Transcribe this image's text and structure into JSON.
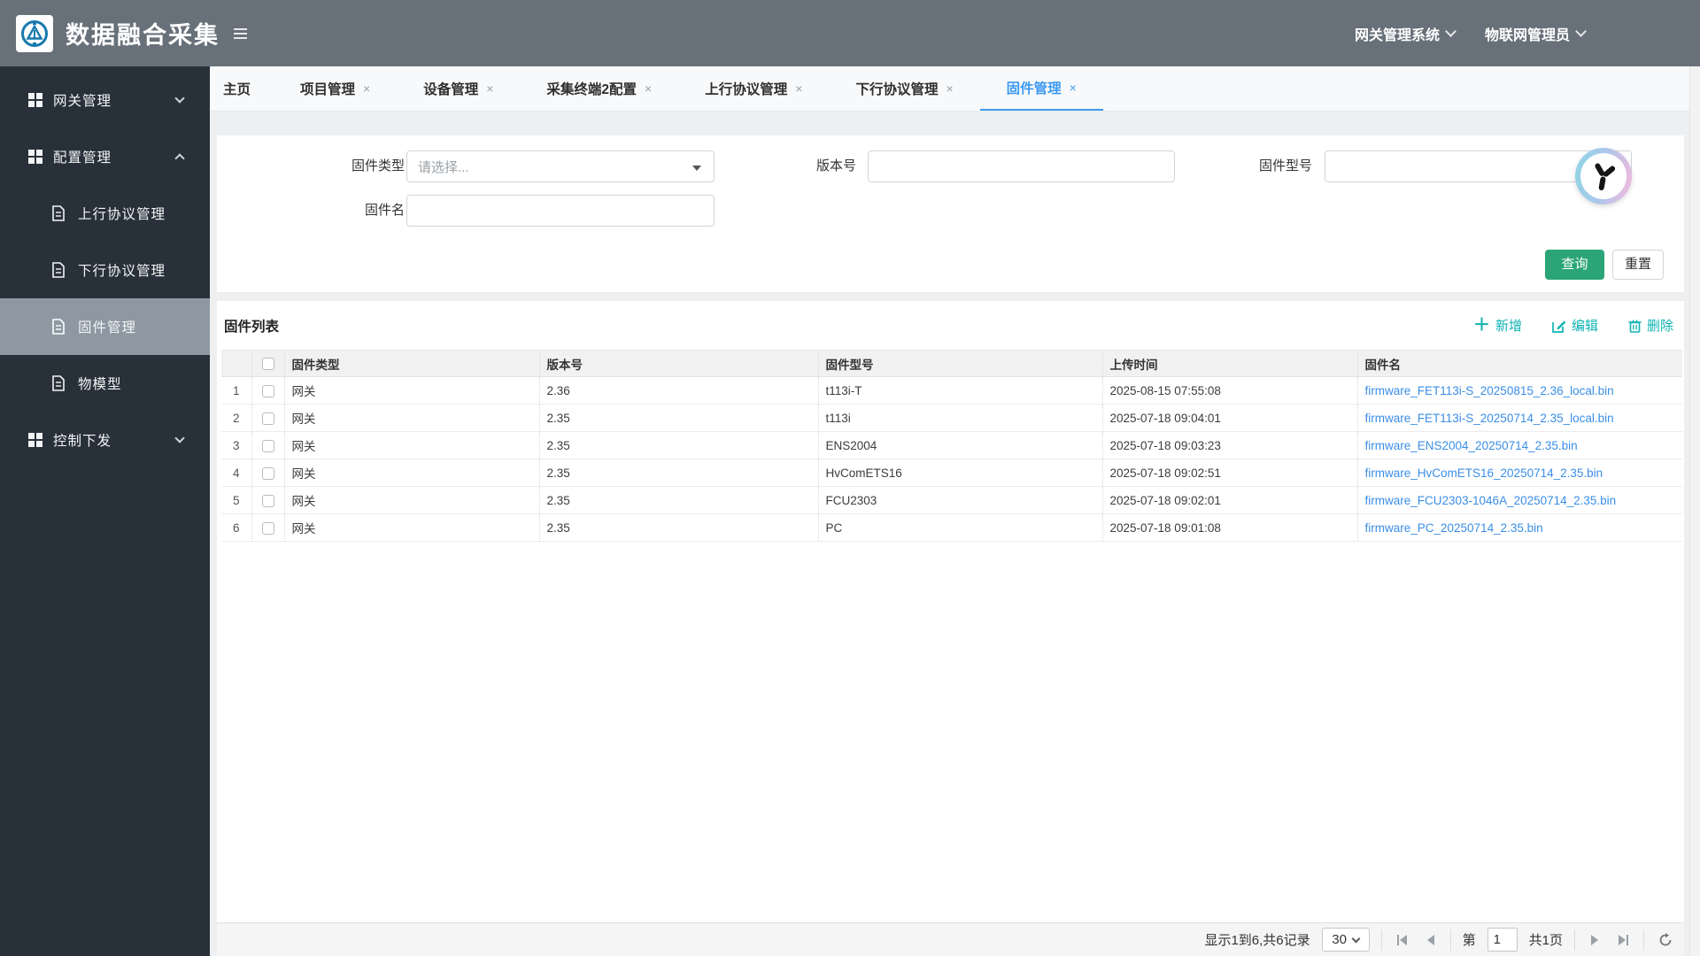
{
  "header": {
    "title": "数据融合采集",
    "right_menus": [
      {
        "label": "网关管理系统"
      },
      {
        "label": "物联网管理员"
      }
    ]
  },
  "sidebar": {
    "items": [
      {
        "label": "网关管理"
      },
      {
        "label": "配置管理"
      },
      {
        "label": "上行协议管理"
      },
      {
        "label": "下行协议管理"
      },
      {
        "label": "固件管理"
      },
      {
        "label": "物模型"
      },
      {
        "label": "控制下发"
      }
    ]
  },
  "tabs": {
    "items": [
      {
        "label": "主页"
      },
      {
        "label": "项目管理"
      },
      {
        "label": "设备管理"
      },
      {
        "label": "采集终端2配置"
      },
      {
        "label": "上行协议管理"
      },
      {
        "label": "下行协议管理"
      },
      {
        "label": "固件管理"
      }
    ],
    "close_glyph": "×"
  },
  "search": {
    "type_label": "固件类型",
    "type_placeholder": "请选择...",
    "version_label": "版本号",
    "model_label": "固件型号",
    "name_label": "固件名",
    "query_button": "查询",
    "reset_button": "重置"
  },
  "list": {
    "title": "固件列表",
    "actions": {
      "add": "新增",
      "edit": "编辑",
      "delete": "删除"
    },
    "columns": {
      "type": "固件类型",
      "version": "版本号",
      "model": "固件型号",
      "time": "上传时间",
      "name": "固件名"
    },
    "rows": [
      {
        "index": "1",
        "type": "网关",
        "version": "2.36",
        "model": "t113i-T",
        "time": "2025-08-15 07:55:08",
        "name": "firmware_FET113i-S_20250815_2.36_local.bin"
      },
      {
        "index": "2",
        "type": "网关",
        "version": "2.35",
        "model": "t113i",
        "time": "2025-07-18 09:04:01",
        "name": "firmware_FET113i-S_20250714_2.35_local.bin"
      },
      {
        "index": "3",
        "type": "网关",
        "version": "2.35",
        "model": "ENS2004",
        "time": "2025-07-18 09:03:23",
        "name": "firmware_ENS2004_20250714_2.35.bin"
      },
      {
        "index": "4",
        "type": "网关",
        "version": "2.35",
        "model": "HvComETS16",
        "time": "2025-07-18 09:02:51",
        "name": "firmware_HvComETS16_20250714_2.35.bin"
      },
      {
        "index": "5",
        "type": "网关",
        "version": "2.35",
        "model": "FCU2303",
        "time": "2025-07-18 09:02:01",
        "name": "firmware_FCU2303-1046A_20250714_2.35.bin"
      },
      {
        "index": "6",
        "type": "网关",
        "version": "2.35",
        "model": "PC",
        "time": "2025-07-18 09:01:08",
        "name": "firmware_PC_20250714_2.35.bin"
      }
    ]
  },
  "pagination": {
    "summary": "显示1到6,共6记录",
    "page_size": "30",
    "page_prefix": "第",
    "page_value": "1",
    "total_pages": "共1页"
  },
  "colors": {
    "header_bg": "#687079",
    "sidebar_bg": "#28313a",
    "sidebar_active_bg": "#8d98a2",
    "tab_active": "#3d9af2",
    "query_button_bg": "#2ba578",
    "action_teal": "#10b3b3",
    "link_blue": "#3a8ee6",
    "widget_ring_left": "#8ed6e2",
    "widget_ring_right": "#f4b9dd"
  }
}
